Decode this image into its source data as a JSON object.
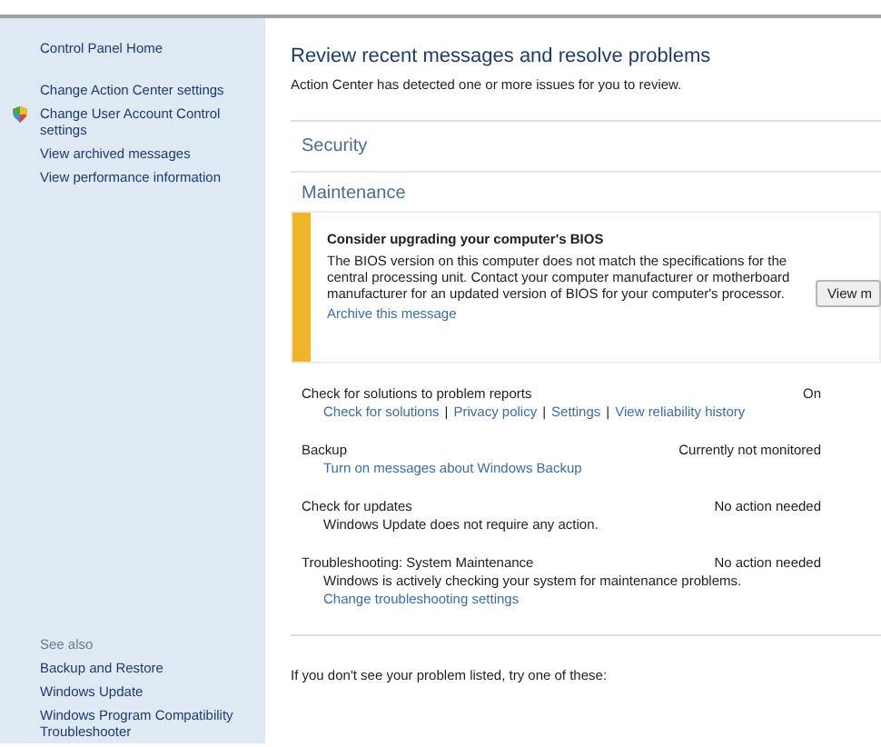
{
  "sidebar": {
    "items": [
      {
        "label": "Control Panel Home",
        "shield": false
      },
      {
        "label": "Change Action Center settings",
        "shield": false
      },
      {
        "label": "Change User Account Control settings",
        "shield": true
      },
      {
        "label": "View archived messages",
        "shield": false
      },
      {
        "label": "View performance information",
        "shield": false
      }
    ],
    "see_also": {
      "heading": "See also",
      "items": [
        "Backup and Restore",
        "Windows Update",
        "Windows Program Compatibility Troubleshooter"
      ]
    }
  },
  "main": {
    "title": "Review recent messages and resolve problems",
    "subtitle": "Action Center has detected one or more issues for you to review.",
    "sections": [
      {
        "label": "Security"
      },
      {
        "label": "Maintenance"
      }
    ],
    "alert": {
      "title": "Consider upgrading your computer's BIOS",
      "body": "The BIOS version on this computer does not match the specifications for the central processing unit. Contact your computer manufacturer or motherboard manufacturer for an updated version of BIOS for your computer's processor.",
      "link": "Archive this message",
      "button": "View m"
    },
    "rows": [
      {
        "name": "Check for solutions to problem reports",
        "status": "On",
        "links": [
          "Check for solutions",
          "Privacy policy",
          "Settings",
          "View reliability history"
        ],
        "separator": "|"
      },
      {
        "name": "Backup",
        "status": "Currently not monitored",
        "links": [
          "Turn on messages about Windows Backup"
        ]
      },
      {
        "name": "Check for updates",
        "status": "No action needed",
        "text": "Windows Update does not require any action."
      },
      {
        "name": "Troubleshooting: System Maintenance",
        "status": "No action needed",
        "text": "Windows is actively checking your system for maintenance problems.",
        "links": [
          "Change troubleshooting settings"
        ]
      }
    ],
    "footer": "If you don't see your problem listed, try one of these:"
  }
}
